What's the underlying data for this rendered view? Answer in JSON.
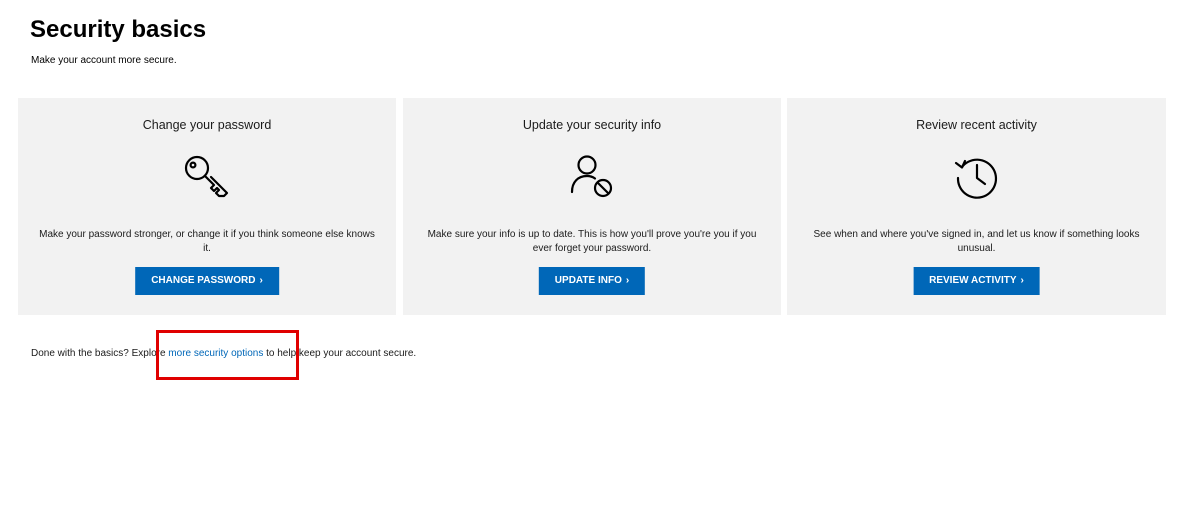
{
  "page": {
    "title": "Security basics",
    "subtitle": "Make your account more secure."
  },
  "cards": [
    {
      "title": "Change your password",
      "icon": "key-icon",
      "description": "Make your password stronger, or change it if you think someone else knows it.",
      "button_label": "CHANGE PASSWORD",
      "button_chevron": "›"
    },
    {
      "title": "Update your security info",
      "icon": "user-blocked-icon",
      "description": "Make sure your info is up to date. This is how you'll prove you're you if you ever forget your password.",
      "button_label": "UPDATE INFO",
      "button_chevron": "›"
    },
    {
      "title": "Review recent activity",
      "icon": "history-clock-icon",
      "description": "See when and where you've signed in, and let us know if something looks unusual.",
      "button_label": "REVIEW ACTIVITY",
      "button_chevron": "›"
    }
  ],
  "footer": {
    "prefix": "Done with the basics? Explore ",
    "link_text": "more security options",
    "suffix": " to help keep your account secure."
  },
  "colors": {
    "accent": "#0067b8",
    "card_background": "#f2f2f2",
    "highlight": "#e00000"
  }
}
